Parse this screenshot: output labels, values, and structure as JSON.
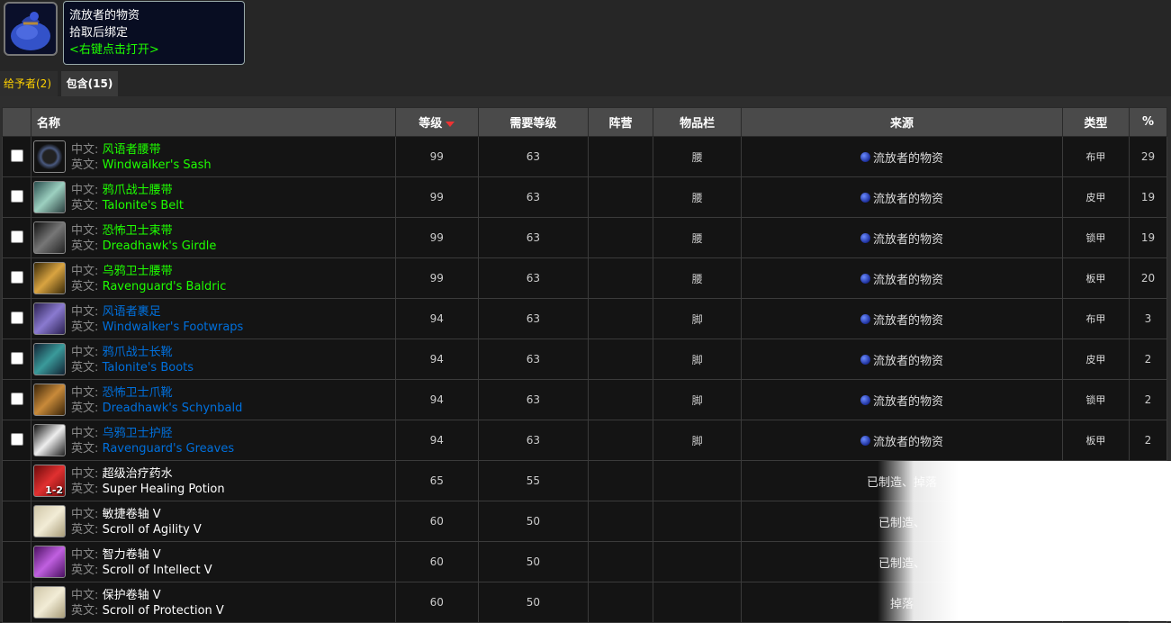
{
  "item": {
    "title": "流放者的物资",
    "bind": "拾取后绑定",
    "action": "<右键点击打开>"
  },
  "tabs": [
    {
      "label": "给予者(2)"
    },
    {
      "label": "包含(15)"
    }
  ],
  "columns": {
    "name": "名称",
    "level": "等级",
    "req_level": "需要等级",
    "faction": "阵营",
    "slot": "物品栏",
    "source": "来源",
    "type": "类型",
    "pct": "%"
  },
  "labels": {
    "cn": "中文:",
    "en": "英文:"
  },
  "colors": {
    "uncommon": "#1eff00",
    "rare": "#0070dd",
    "common": "#ffffff"
  },
  "rows": [
    {
      "cn": "风语者腰带",
      "en": "Windwalker's Sash",
      "quality": "uncommon",
      "icon": "sash-icon",
      "level": "99",
      "req": "63",
      "slot": "腰",
      "source": "流放者的物资",
      "type": "布甲",
      "pct": "29"
    },
    {
      "cn": "鸦爪战士腰带",
      "en": "Talonite's Belt",
      "quality": "uncommon",
      "icon": "belt-icon",
      "level": "99",
      "req": "63",
      "slot": "腰",
      "source": "流放者的物资",
      "type": "皮甲",
      "pct": "19"
    },
    {
      "cn": "恐怖卫士束带",
      "en": "Dreadhawk's Girdle",
      "quality": "uncommon",
      "icon": "girdle-icon",
      "level": "99",
      "req": "63",
      "slot": "腰",
      "source": "流放者的物资",
      "type": "锁甲",
      "pct": "19"
    },
    {
      "cn": "乌鸦卫士腰带",
      "en": "Ravenguard's Baldric",
      "quality": "uncommon",
      "icon": "baldric-icon",
      "level": "99",
      "req": "63",
      "slot": "腰",
      "source": "流放者的物资",
      "type": "板甲",
      "pct": "20"
    },
    {
      "cn": "风语者裹足",
      "en": "Windwalker's Footwraps",
      "quality": "rare",
      "icon": "footwraps-icon",
      "level": "94",
      "req": "63",
      "slot": "脚",
      "source": "流放者的物资",
      "type": "布甲",
      "pct": "3"
    },
    {
      "cn": "鸦爪战士长靴",
      "en": "Talonite's Boots",
      "quality": "rare",
      "icon": "boots-icon",
      "level": "94",
      "req": "63",
      "slot": "脚",
      "source": "流放者的物资",
      "type": "皮甲",
      "pct": "2"
    },
    {
      "cn": "恐怖卫士爪靴",
      "en": "Dreadhawk's Schynbald",
      "quality": "rare",
      "icon": "schynbald-icon",
      "level": "94",
      "req": "63",
      "slot": "脚",
      "source": "流放者的物资",
      "type": "锁甲",
      "pct": "2"
    },
    {
      "cn": "乌鸦卫士护胫",
      "en": "Ravenguard's Greaves",
      "quality": "rare",
      "icon": "greaves-icon",
      "level": "94",
      "req": "63",
      "slot": "脚",
      "source": "流放者的物资",
      "type": "板甲",
      "pct": "2"
    },
    {
      "cn": "超级治疗药水",
      "en": "Super Healing Potion",
      "quality": "common",
      "icon": "potion-icon",
      "stack": "1-2",
      "level": "65",
      "req": "55",
      "slot": "",
      "source_text": "已制造、掉落",
      "type": "",
      "pct": ""
    },
    {
      "cn": "敏捷卷轴 V",
      "en": "Scroll of Agility V",
      "quality": "common",
      "icon": "scroll-icon",
      "level": "60",
      "req": "50",
      "slot": "",
      "source_text": "已制造、",
      "type": "",
      "pct": ""
    },
    {
      "cn": "智力卷轴 V",
      "en": "Scroll of Intellect V",
      "quality": "common",
      "icon": "scroll-icon",
      "level": "60",
      "req": "50",
      "slot": "",
      "source_text": "已制造、",
      "type": "",
      "pct": ""
    },
    {
      "cn": "保护卷轴 V",
      "en": "Scroll of Protection V",
      "quality": "common",
      "icon": "scroll-icon",
      "level": "60",
      "req": "50",
      "slot": "",
      "source_text": "掉落",
      "type": "",
      "pct": ""
    }
  ]
}
